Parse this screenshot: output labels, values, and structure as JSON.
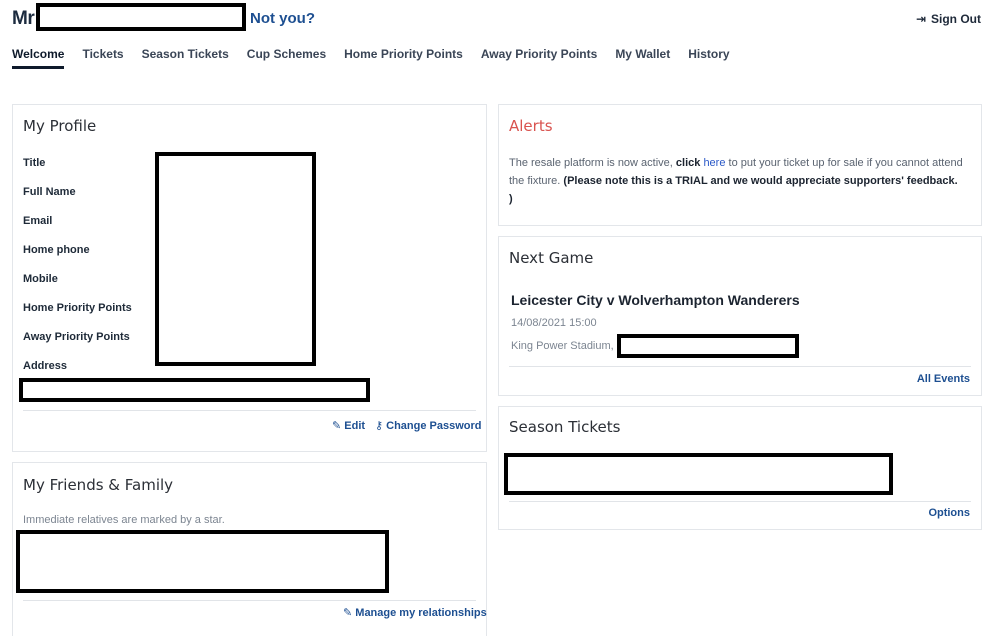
{
  "header": {
    "greeting": "Mr",
    "not_you": "Not you?",
    "sign_out": "Sign Out",
    "sign_out_icon": "sign-out-icon"
  },
  "tabs": [
    {
      "label": "Welcome",
      "active": true
    },
    {
      "label": "Tickets"
    },
    {
      "label": "Season Tickets"
    },
    {
      "label": "Cup Schemes"
    },
    {
      "label": "Home Priority Points"
    },
    {
      "label": "Away Priority Points"
    },
    {
      "label": "My Wallet"
    },
    {
      "label": "History"
    }
  ],
  "profile": {
    "title": "My Profile",
    "fields": {
      "title": "Title",
      "full_name": "Full Name",
      "email": "Email",
      "home_phone": "Home phone",
      "mobile": "Mobile",
      "home_points": "Home Priority Points",
      "away_points": "Away Priority Points",
      "address": "Address"
    },
    "edit": "Edit",
    "change_password": "Change Password"
  },
  "friends": {
    "title": "My Friends & Family",
    "note": "Immediate relatives are marked by a star.",
    "manage": "Manage my relationships"
  },
  "alerts": {
    "title": "Alerts",
    "text1": "The resale platform is now active, ",
    "click": "click",
    "here": "here",
    "text2": " to put your ticket up for sale if you cannot attend the fixture. ",
    "note": "(Please note this is a TRIAL and we would appreciate supporters' feedback. )"
  },
  "next_game": {
    "title": "Next Game",
    "match": "Leicester City v Wolverhampton Wanderers",
    "datetime": "14/08/2021 15:00",
    "venue": "King Power Stadium,",
    "all_events": "All Events"
  },
  "season_tickets": {
    "title": "Season Tickets",
    "options": "Options"
  },
  "colors": {
    "link": "#1d4f91",
    "alert_title": "#d9534f",
    "text": "#1f2a3a"
  }
}
